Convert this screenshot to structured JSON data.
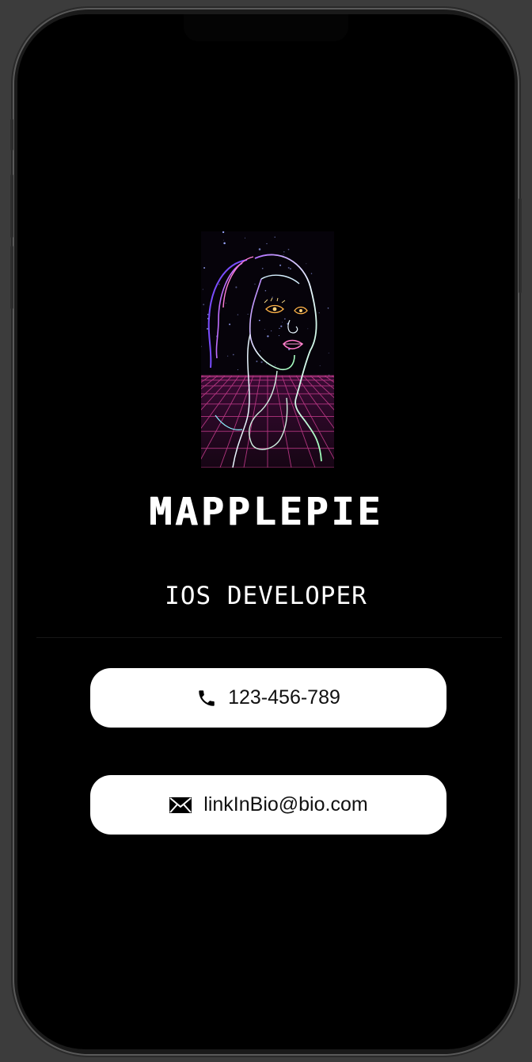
{
  "profile": {
    "name": "MAPPLEPIE",
    "role": "IOS DEVELOPER"
  },
  "contacts": {
    "phone": {
      "label": "123-456-789",
      "icon": "phone-icon"
    },
    "email": {
      "label": "linkInBio@bio.com",
      "icon": "envelope-icon"
    }
  },
  "colors": {
    "background": "#000000",
    "card": "#ffffff",
    "text_on_card": "#111111",
    "grid": "#c23a8a"
  }
}
